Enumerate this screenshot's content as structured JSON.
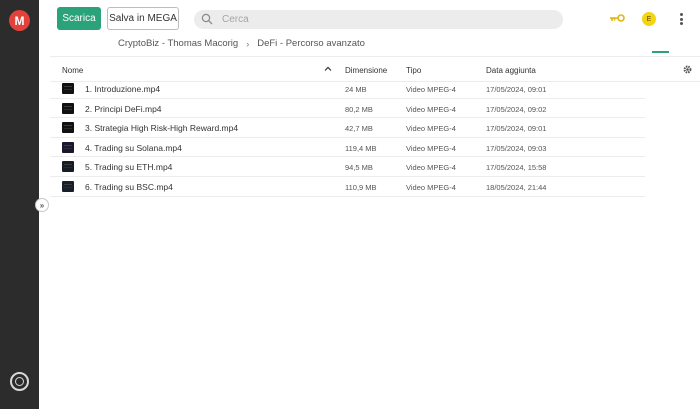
{
  "toolbar": {
    "download_label": "Scarica",
    "save_label": "Salva in MEGA"
  },
  "search": {
    "placeholder": "Cerca",
    "value": ""
  },
  "account": {
    "avatar_initial": "E"
  },
  "breadcrumb": [
    "CryptoBiz - Thomas Macorig",
    "DeFi - Percorso avanzato"
  ],
  "table": {
    "headers": {
      "name": "Nome",
      "size": "Dimensione",
      "type": "Tipo",
      "date": "Data aggiunta"
    },
    "rows": [
      {
        "name": "1. Introduzione.mp4",
        "size": "24 MB",
        "type": "Video MPEG-4",
        "date": "17/05/2024, 09:01"
      },
      {
        "name": "2. Principi DeFi.mp4",
        "size": "80,2 MB",
        "type": "Video MPEG-4",
        "date": "17/05/2024, 09:02"
      },
      {
        "name": "3. Strategia High Risk-High Reward.mp4",
        "size": "42,7 MB",
        "type": "Video MPEG-4",
        "date": "17/05/2024, 09:01"
      },
      {
        "name": "4. Trading su Solana.mp4",
        "size": "119,4 MB",
        "type": "Video MPEG-4",
        "date": "17/05/2024, 09:03"
      },
      {
        "name": "5. Trading su ETH.mp4",
        "size": "94,5 MB",
        "type": "Video MPEG-4",
        "date": "17/05/2024, 15:58"
      },
      {
        "name": "6. Trading su BSC.mp4",
        "size": "110,9 MB",
        "type": "Video MPEG-4",
        "date": "18/05/2024, 21:44"
      }
    ]
  },
  "icons": {
    "logo": "mega-logo-icon",
    "search": "search-icon",
    "key": "key-icon",
    "menu": "kebab-menu-icon",
    "thumbnail_view": "thumbnail-view-icon",
    "list_view": "list-view-icon",
    "grid_view": "grid-view-icon",
    "sort": "sort-chevron-up-icon",
    "settings": "gear-icon",
    "expand": "expand-sidebar-icon",
    "bottom": "mega-sync-icon",
    "file": "video-thumbnail-icon"
  },
  "colors": {
    "accent": "#2ba37a",
    "logo": "#e3413c",
    "rail": "#2c2c2c",
    "avatar": "#f5d510",
    "key": "#e2b80b"
  }
}
